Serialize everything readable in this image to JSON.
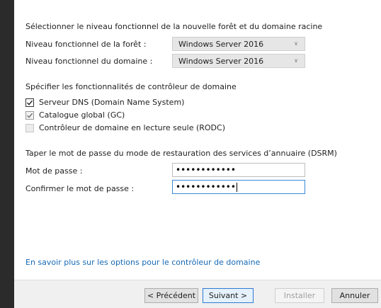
{
  "forest_section": {
    "heading": "Sélectionner le niveau fonctionnel de la nouvelle forêt et du domaine racine",
    "forest_label": "Niveau fonctionnel de la forêt :",
    "forest_value": "Windows Server 2016",
    "domain_label": "Niveau fonctionnel du domaine :",
    "domain_value": "Windows Server 2016"
  },
  "dc_section": {
    "heading": "Spécifier les fonctionnalités de contrôleur de domaine",
    "options": [
      {
        "label": "Serveur DNS (Domain Name System)",
        "checked": true,
        "enabled": true
      },
      {
        "label": "Catalogue global (GC)",
        "checked": true,
        "enabled": false
      },
      {
        "label": "Contrôleur de domaine en lecture seule (RODC)",
        "checked": false,
        "enabled": false
      }
    ]
  },
  "dsrm_section": {
    "heading": "Taper le mot de passe du mode de restauration des services d’annuaire (DSRM)",
    "password_label": "Mot de passe :",
    "password_value": "••••••••••••",
    "confirm_label": "Confirmer le mot de passe :",
    "confirm_value": "••••••••••••"
  },
  "learn_more_link": "En savoir plus sur les options pour le contrôleur de domaine",
  "footer": {
    "previous": "< Précédent",
    "next": "Suivant >",
    "install": "Installer",
    "cancel": "Annuler"
  },
  "colors": {
    "link": "#1669b5",
    "focus_border": "#3a89d6"
  },
  "icons": {
    "dropdown": "chevron-down-icon",
    "check": "checkmark-icon"
  }
}
